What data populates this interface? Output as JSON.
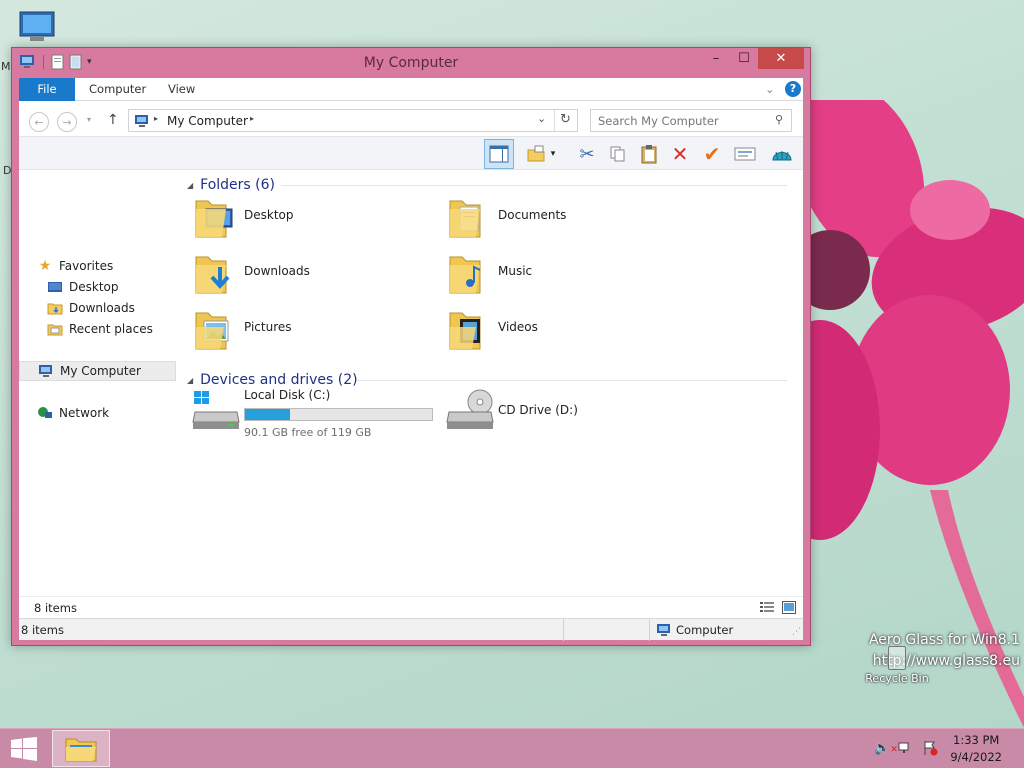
{
  "window": {
    "title": "My Computer",
    "controls": {
      "minimize": "–",
      "maximize": "☐",
      "close": "✕"
    }
  },
  "ribbon": {
    "tabs": [
      "File",
      "Computer",
      "View"
    ]
  },
  "address": {
    "path": "My Computer",
    "search_placeholder": "Search My Computer"
  },
  "nav_pane": {
    "favorites": "Favorites",
    "favorite_items": [
      "Desktop",
      "Downloads",
      "Recent places"
    ],
    "computer": "My Computer",
    "network": "Network"
  },
  "content": {
    "folders_header": "Folders (6)",
    "folders": [
      {
        "name": "Desktop",
        "icon": "desktop-folder-icon"
      },
      {
        "name": "Documents",
        "icon": "documents-folder-icon"
      },
      {
        "name": "Downloads",
        "icon": "downloads-folder-icon"
      },
      {
        "name": "Music",
        "icon": "music-folder-icon"
      },
      {
        "name": "Pictures",
        "icon": "pictures-folder-icon"
      },
      {
        "name": "Videos",
        "icon": "videos-folder-icon"
      }
    ],
    "drives_header": "Devices and drives (2)",
    "drives": [
      {
        "name": "Local Disk (C:)",
        "free": "90.1 GB free of 119 GB",
        "used_fraction": 0.24
      },
      {
        "name": "CD Drive (D:)"
      }
    ]
  },
  "status": {
    "items_top": "8 items",
    "items_bottom": "8 items",
    "location": "Computer"
  },
  "desktop": {
    "watermark_line1": "Aero Glass for Win8.1",
    "watermark_line2": "http://www.glass8.eu",
    "recycle_bin": "Recycle Bin",
    "edge_letters": [
      "M",
      "D"
    ]
  },
  "taskbar": {
    "time": "1:33 PM",
    "date": "9/4/2022"
  },
  "colors": {
    "accent": "#1979ca",
    "window_frame": "#d87aa0",
    "taskbar": "#c88aa6",
    "drive_bar": "#26a0da"
  }
}
